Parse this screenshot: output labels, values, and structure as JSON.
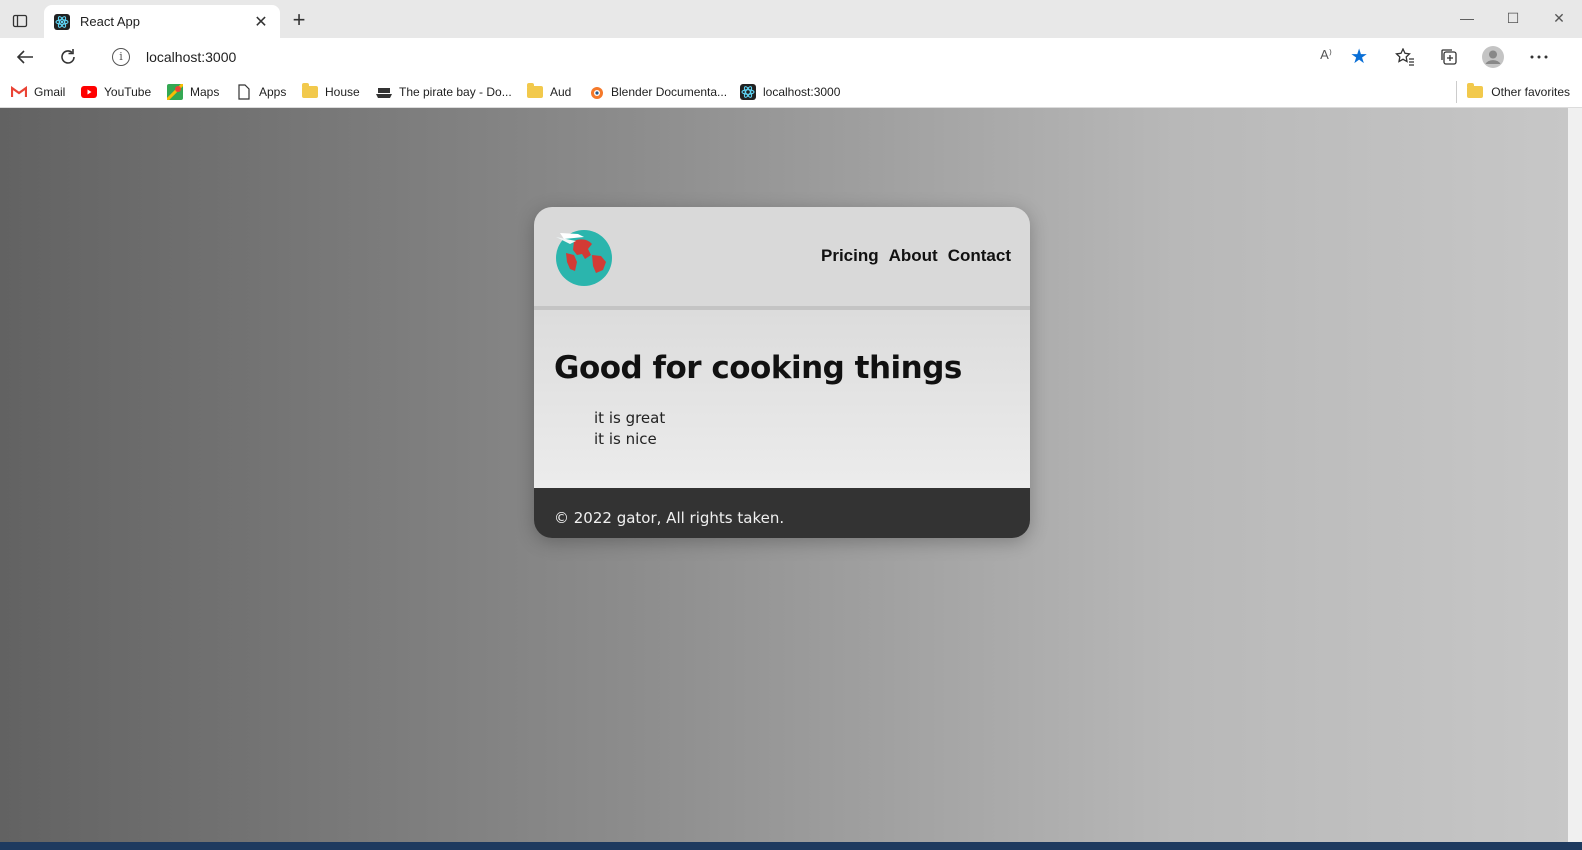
{
  "browser": {
    "tab_title": "React App",
    "tab_close": "✕",
    "new_tab": "+",
    "url": "localhost:3000",
    "read_aloud": "A⁾",
    "window_controls": {
      "minimize": "—",
      "maximize": "☐",
      "close": "✕"
    }
  },
  "bookmarks": {
    "items": [
      {
        "label": "Gmail",
        "icon": "gmail-icon"
      },
      {
        "label": "YouTube",
        "icon": "youtube-icon"
      },
      {
        "label": "Maps",
        "icon": "maps-icon"
      },
      {
        "label": "Apps",
        "icon": "page-icon"
      },
      {
        "label": "House",
        "icon": "folder-icon"
      },
      {
        "label": "The pirate bay - Do...",
        "icon": "ship-icon"
      },
      {
        "label": "Aud",
        "icon": "folder-icon"
      },
      {
        "label": "Blender Documenta...",
        "icon": "blender-icon"
      },
      {
        "label": "localhost:3000",
        "icon": "react-icon"
      }
    ],
    "other_favorites": "Other favorites"
  },
  "page": {
    "nav": {
      "pricing": "Pricing",
      "about": "About",
      "contact": "Contact"
    },
    "heading": "Good for cooking things",
    "list": [
      "it is great",
      "it is nice"
    ],
    "footer": "© 2022 gator, All rights taken."
  },
  "colors": {
    "card_header": "#d9d9d9",
    "card_footer": "#333333",
    "accent_star": "#0a6fd6"
  }
}
